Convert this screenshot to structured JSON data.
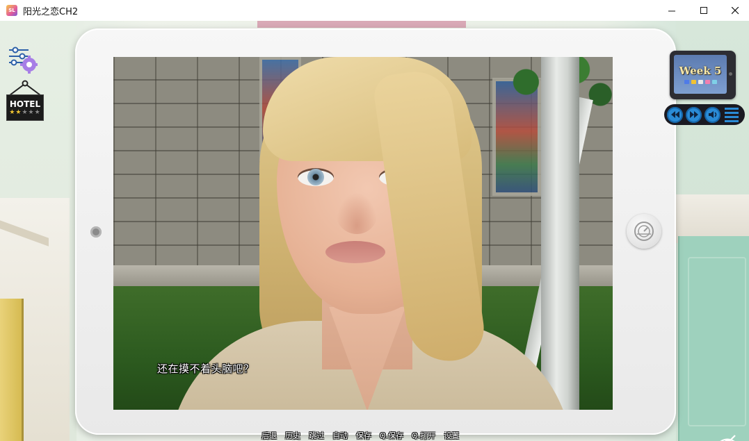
{
  "window": {
    "title": "阳光之恋CH2",
    "app_icon_label": "SL",
    "controls": [
      "minimize",
      "maximize",
      "close"
    ]
  },
  "hud": {
    "settings_icon": "sliders-gear-icon",
    "hotel": {
      "label": "HOTEL",
      "stars_filled": 2,
      "stars_total": 5
    },
    "phone": {
      "week_label": "Week 5",
      "app_colors": [
        "#4f7be8",
        "#f1c232",
        "#e8e8e8",
        "#f07fb0",
        "#7fd1e8"
      ]
    },
    "media": [
      "rewind-icon",
      "fast-forward-icon",
      "volume-icon",
      "menu-icon"
    ]
  },
  "dialogue": {
    "text": "还在摸不着头脑吧？"
  },
  "quick_menu": {
    "items": [
      "后退",
      "历史",
      "跳过",
      "自动",
      "保存",
      "Q.保存",
      "Q.打开",
      "设置"
    ]
  },
  "colors": {
    "media_accent": "#2a8bd6",
    "tablet_frame": "#efefef",
    "hotel_star": "#f0c431"
  }
}
